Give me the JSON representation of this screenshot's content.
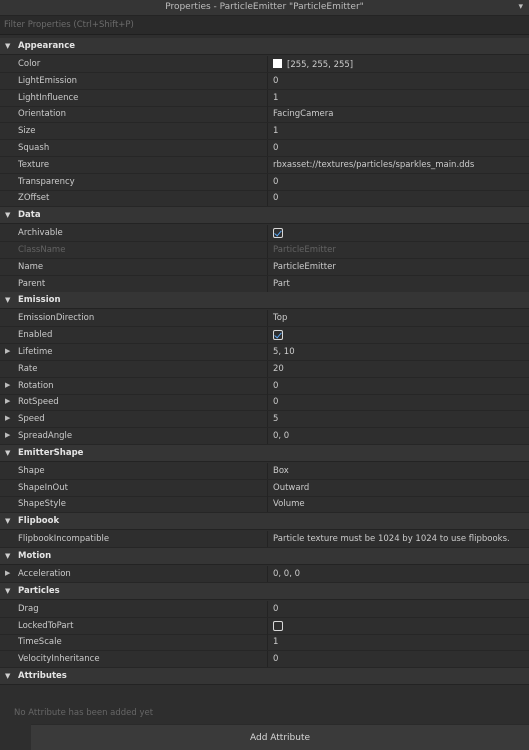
{
  "window": {
    "title": "Properties - ParticleEmitter \"ParticleEmitter\"",
    "dropdown_icon": "chevron-down-icon"
  },
  "filter": {
    "placeholder": "Filter Properties (Ctrl+Shift+P)"
  },
  "categories": [
    {
      "name": "Appearance",
      "properties": [
        {
          "name": "Color",
          "value": "[255, 255, 255]",
          "swatch": "#ffffff"
        },
        {
          "name": "LightEmission",
          "value": "0"
        },
        {
          "name": "LightInfluence",
          "value": "1"
        },
        {
          "name": "Orientation",
          "value": "FacingCamera"
        },
        {
          "name": "Size",
          "value": "1"
        },
        {
          "name": "Squash",
          "value": "0"
        },
        {
          "name": "Texture",
          "value": "rbxasset://textures/particles/sparkles_main.dds"
        },
        {
          "name": "Transparency",
          "value": "0"
        },
        {
          "name": "ZOffset",
          "value": "0"
        }
      ]
    },
    {
      "name": "Data",
      "properties": [
        {
          "name": "Archivable",
          "checkbox": true
        },
        {
          "name": "ClassName",
          "value": "ParticleEmitter",
          "disabled": true
        },
        {
          "name": "Name",
          "value": "ParticleEmitter"
        },
        {
          "name": "Parent",
          "value": "Part"
        }
      ]
    },
    {
      "name": "Emission",
      "properties": [
        {
          "name": "EmissionDirection",
          "value": "Top"
        },
        {
          "name": "Enabled",
          "checkbox": true
        },
        {
          "name": "Lifetime",
          "value": "5, 10",
          "expandable": true
        },
        {
          "name": "Rate",
          "value": "20"
        },
        {
          "name": "Rotation",
          "value": "0",
          "expandable": true
        },
        {
          "name": "RotSpeed",
          "value": "0",
          "expandable": true
        },
        {
          "name": "Speed",
          "value": "5",
          "expandable": true
        },
        {
          "name": "SpreadAngle",
          "value": "0, 0",
          "expandable": true
        }
      ]
    },
    {
      "name": "EmitterShape",
      "properties": [
        {
          "name": "Shape",
          "value": "Box"
        },
        {
          "name": "ShapeInOut",
          "value": "Outward"
        },
        {
          "name": "ShapeStyle",
          "value": "Volume"
        }
      ]
    },
    {
      "name": "Flipbook",
      "properties": [
        {
          "name": "FlipbookIncompatible",
          "value": "Particle texture must be 1024 by 1024 to use flipbooks."
        }
      ]
    },
    {
      "name": "Motion",
      "properties": [
        {
          "name": "Acceleration",
          "value": "0, 0, 0",
          "expandable": true
        }
      ]
    },
    {
      "name": "Particles",
      "properties": [
        {
          "name": "Drag",
          "value": "0"
        },
        {
          "name": "LockedToPart",
          "checkbox": false
        },
        {
          "name": "TimeScale",
          "value": "1"
        },
        {
          "name": "VelocityInheritance",
          "value": "0"
        }
      ]
    },
    {
      "name": "Attributes",
      "properties": []
    }
  ],
  "attributes": {
    "empty_text": "No Attribute has been added yet",
    "add_button": "Add Attribute"
  }
}
